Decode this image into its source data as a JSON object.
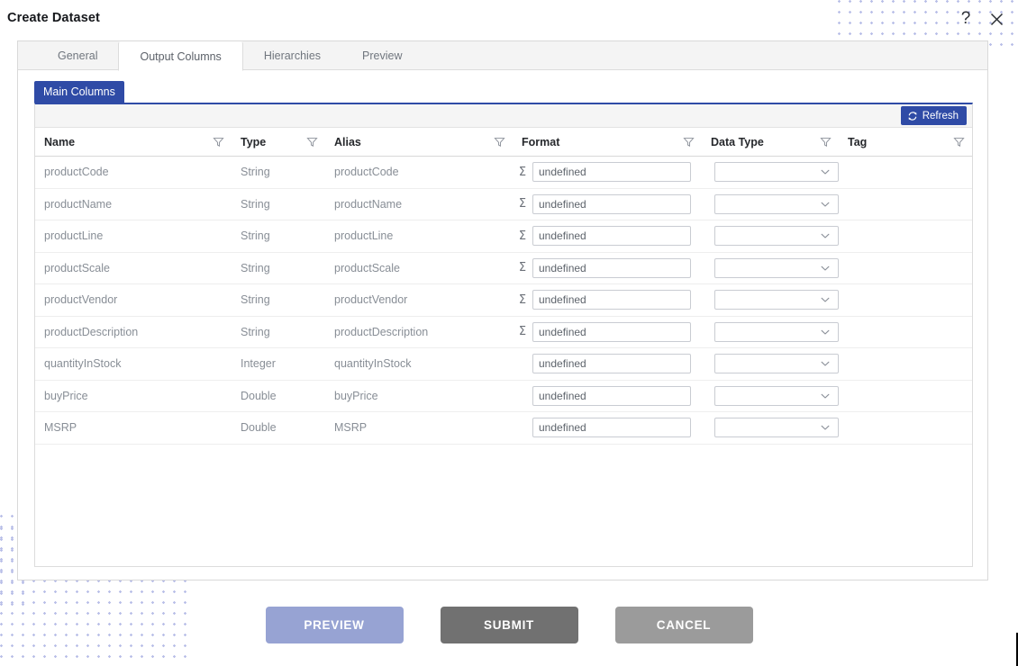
{
  "window": {
    "title": "Create Dataset",
    "help_icon": "question-mark-icon",
    "close_icon": "close-x-icon"
  },
  "tabs": [
    {
      "label": "General",
      "active": false
    },
    {
      "label": "Output Columns",
      "active": true
    },
    {
      "label": "Hierarchies",
      "active": false
    },
    {
      "label": "Preview",
      "active": false
    }
  ],
  "subtabs": [
    {
      "label": "Main Columns",
      "active": true
    }
  ],
  "grid": {
    "toolbar": {
      "refresh_label": "Refresh",
      "refresh_icon": "refresh-icon",
      "refresh_color": "#2f4ba6"
    },
    "columns": [
      {
        "label": "Name",
        "filter_icon": "filter-funnel-icon"
      },
      {
        "label": "Type",
        "filter_icon": "filter-funnel-icon"
      },
      {
        "label": "Alias",
        "filter_icon": "filter-funnel-icon"
      },
      {
        "label": "Format",
        "filter_icon": "filter-funnel-icon"
      },
      {
        "label": "Data Type",
        "filter_icon": "filter-funnel-icon"
      },
      {
        "label": "Tag",
        "filter_icon": "filter-funnel-icon"
      }
    ],
    "sigma_glyph": "Σ",
    "rows": [
      {
        "name": "productCode",
        "type": "String",
        "alias": "productCode",
        "has_sigma": true,
        "format": "undefined",
        "data_type": "",
        "tag": ""
      },
      {
        "name": "productName",
        "type": "String",
        "alias": "productName",
        "has_sigma": true,
        "format": "undefined",
        "data_type": "",
        "tag": ""
      },
      {
        "name": "productLine",
        "type": "String",
        "alias": "productLine",
        "has_sigma": true,
        "format": "undefined",
        "data_type": "",
        "tag": ""
      },
      {
        "name": "productScale",
        "type": "String",
        "alias": "productScale",
        "has_sigma": true,
        "format": "undefined",
        "data_type": "",
        "tag": ""
      },
      {
        "name": "productVendor",
        "type": "String",
        "alias": "productVendor",
        "has_sigma": true,
        "format": "undefined",
        "data_type": "",
        "tag": ""
      },
      {
        "name": "productDescription",
        "type": "String",
        "alias": "productDescription",
        "has_sigma": true,
        "format": "undefined",
        "data_type": "",
        "tag": ""
      },
      {
        "name": "quantityInStock",
        "type": "Integer",
        "alias": "quantityInStock",
        "has_sigma": false,
        "format": "undefined",
        "data_type": "",
        "tag": ""
      },
      {
        "name": "buyPrice",
        "type": "Double",
        "alias": "buyPrice",
        "has_sigma": false,
        "format": "undefined",
        "data_type": "",
        "tag": ""
      },
      {
        "name": "MSRP",
        "type": "Double",
        "alias": "MSRP",
        "has_sigma": false,
        "format": "undefined",
        "data_type": "",
        "tag": ""
      }
    ]
  },
  "footer": {
    "preview_label": "PREVIEW",
    "submit_label": "SUBMIT",
    "cancel_label": "CANCEL",
    "preview_color": "#97a3d3",
    "submit_color": "#717171",
    "cancel_color": "#9b9b9b"
  }
}
